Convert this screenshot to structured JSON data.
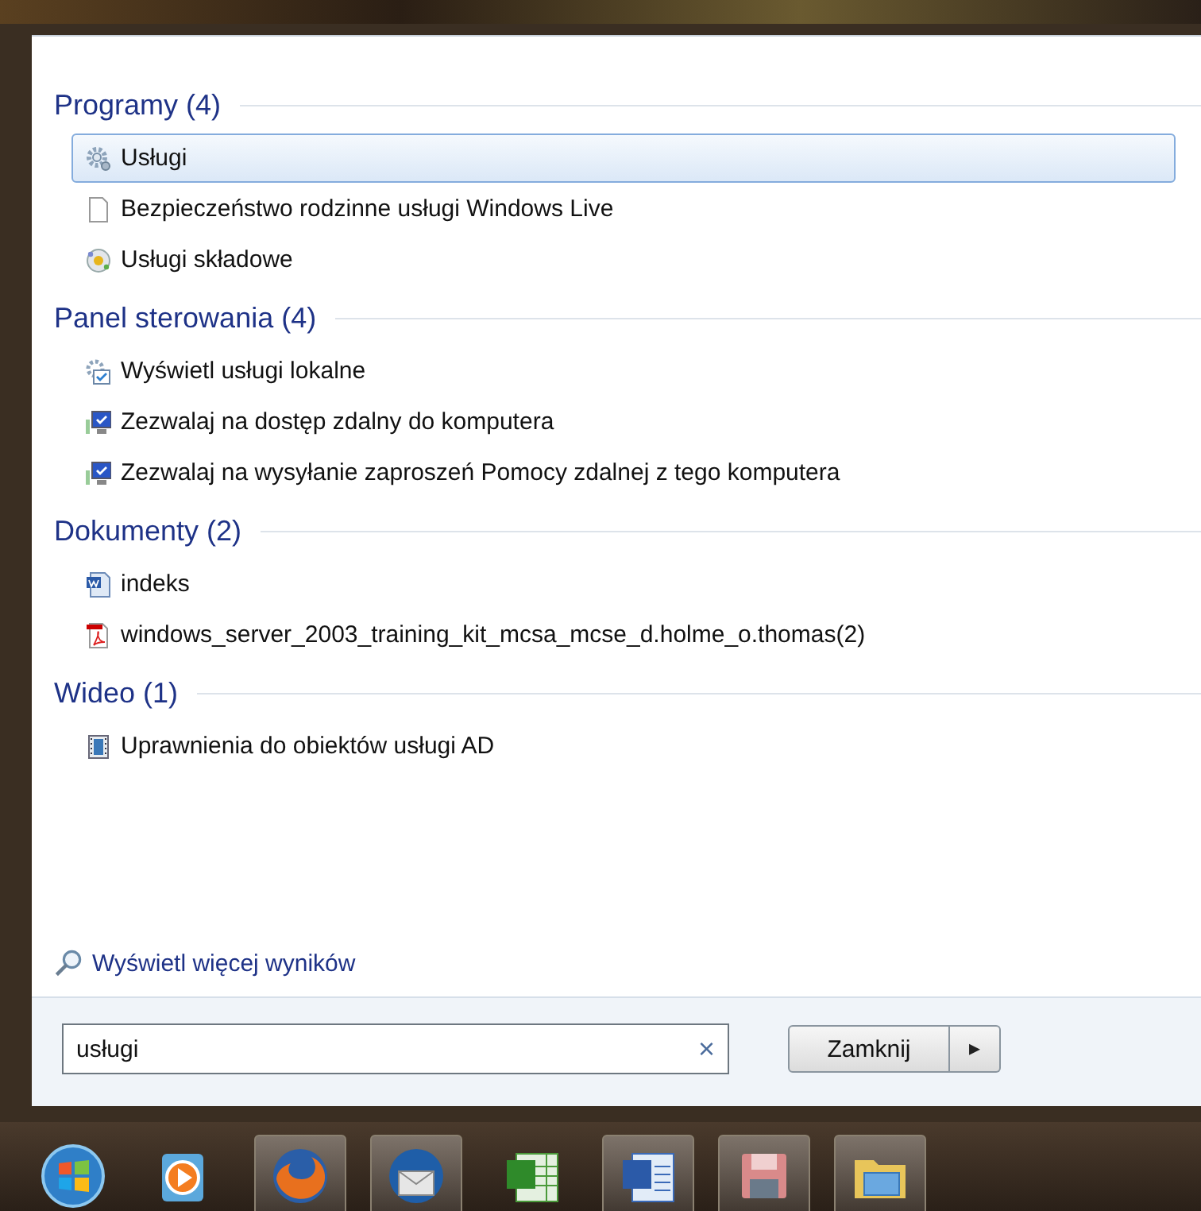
{
  "sections": [
    {
      "title": "Programy (4)",
      "items": [
        {
          "label": "Usługi",
          "kind": "gear",
          "selected": true
        },
        {
          "label": "Bezpieczeństwo rodzinne usługi Windows Live",
          "kind": "page",
          "selected": false
        },
        {
          "label": "Usługi składowe",
          "kind": "component",
          "selected": false
        }
      ]
    },
    {
      "title": "Panel sterowania (4)",
      "items": [
        {
          "label": "Wyświetl usługi lokalne",
          "kind": "services",
          "selected": false
        },
        {
          "label": "Zezwalaj na dostęp zdalny do komputera",
          "kind": "remote",
          "selected": false
        },
        {
          "label": "Zezwalaj na wysyłanie zaproszeń Pomocy zdalnej z tego komputera",
          "kind": "remote",
          "selected": false
        }
      ]
    },
    {
      "title": "Dokumenty (2)",
      "items": [
        {
          "label": "indeks",
          "kind": "word",
          "selected": false
        },
        {
          "label": "windows_server_2003_training_kit_mcsa_mcse_d.holme_o.thomas(2)",
          "kind": "pdf",
          "selected": false
        }
      ]
    },
    {
      "title": "Wideo (1)",
      "items": [
        {
          "label": "Uprawnienia do obiektów usługi AD",
          "kind": "video",
          "selected": false
        }
      ]
    }
  ],
  "more_results": "Wyświetl więcej wyników",
  "search": {
    "value": "usługi",
    "clear": "×"
  },
  "shutdown": {
    "label": "Zamknij",
    "arrow": "▸"
  },
  "taskbar": [
    {
      "kind": "start",
      "running": false
    },
    {
      "kind": "player",
      "running": false
    },
    {
      "kind": "firefox",
      "running": true
    },
    {
      "kind": "mail",
      "running": true
    },
    {
      "kind": "excel",
      "running": false
    },
    {
      "kind": "word",
      "running": true
    },
    {
      "kind": "floppy",
      "running": true
    },
    {
      "kind": "folder",
      "running": true
    }
  ]
}
